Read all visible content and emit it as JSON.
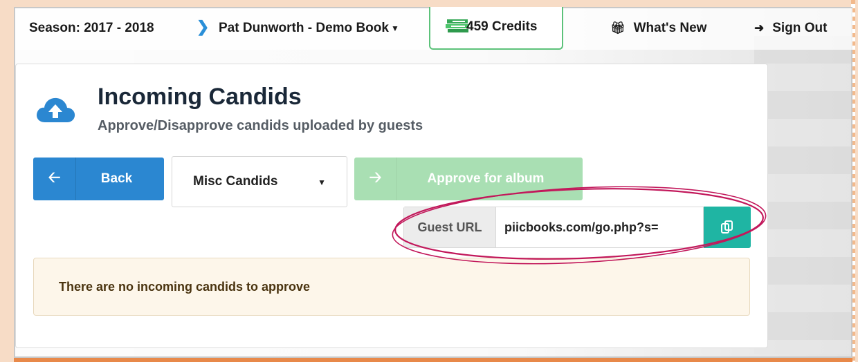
{
  "nav": {
    "season": "Season: 2017 - 2018",
    "chevron_icon": "chevron-right-icon",
    "book": "Pat Dunworth - Demo Book",
    "credits": "459 Credits",
    "whats_new": "What's New",
    "sign_out": "Sign Out"
  },
  "page": {
    "title": "Incoming Candids",
    "subtitle": "Approve/Disapprove candids uploaded by guests",
    "icon": "cloud-upload-icon"
  },
  "toolbar": {
    "back_label": "Back",
    "category_select": "Misc Candids",
    "approve_label": "Approve for album"
  },
  "guest_url": {
    "addon_label": "Guest URL",
    "value": "piicbooks.com/go.php?s=",
    "copy_icon": "copy-icon"
  },
  "alert": {
    "message": "There are no incoming candids to approve"
  },
  "colors": {
    "primary": "#2b87d1",
    "success_disabled": "#a9dfb3",
    "teal": "#1fb5a3",
    "highlight": "#c2185b",
    "frame_orange": "#e8894a"
  }
}
